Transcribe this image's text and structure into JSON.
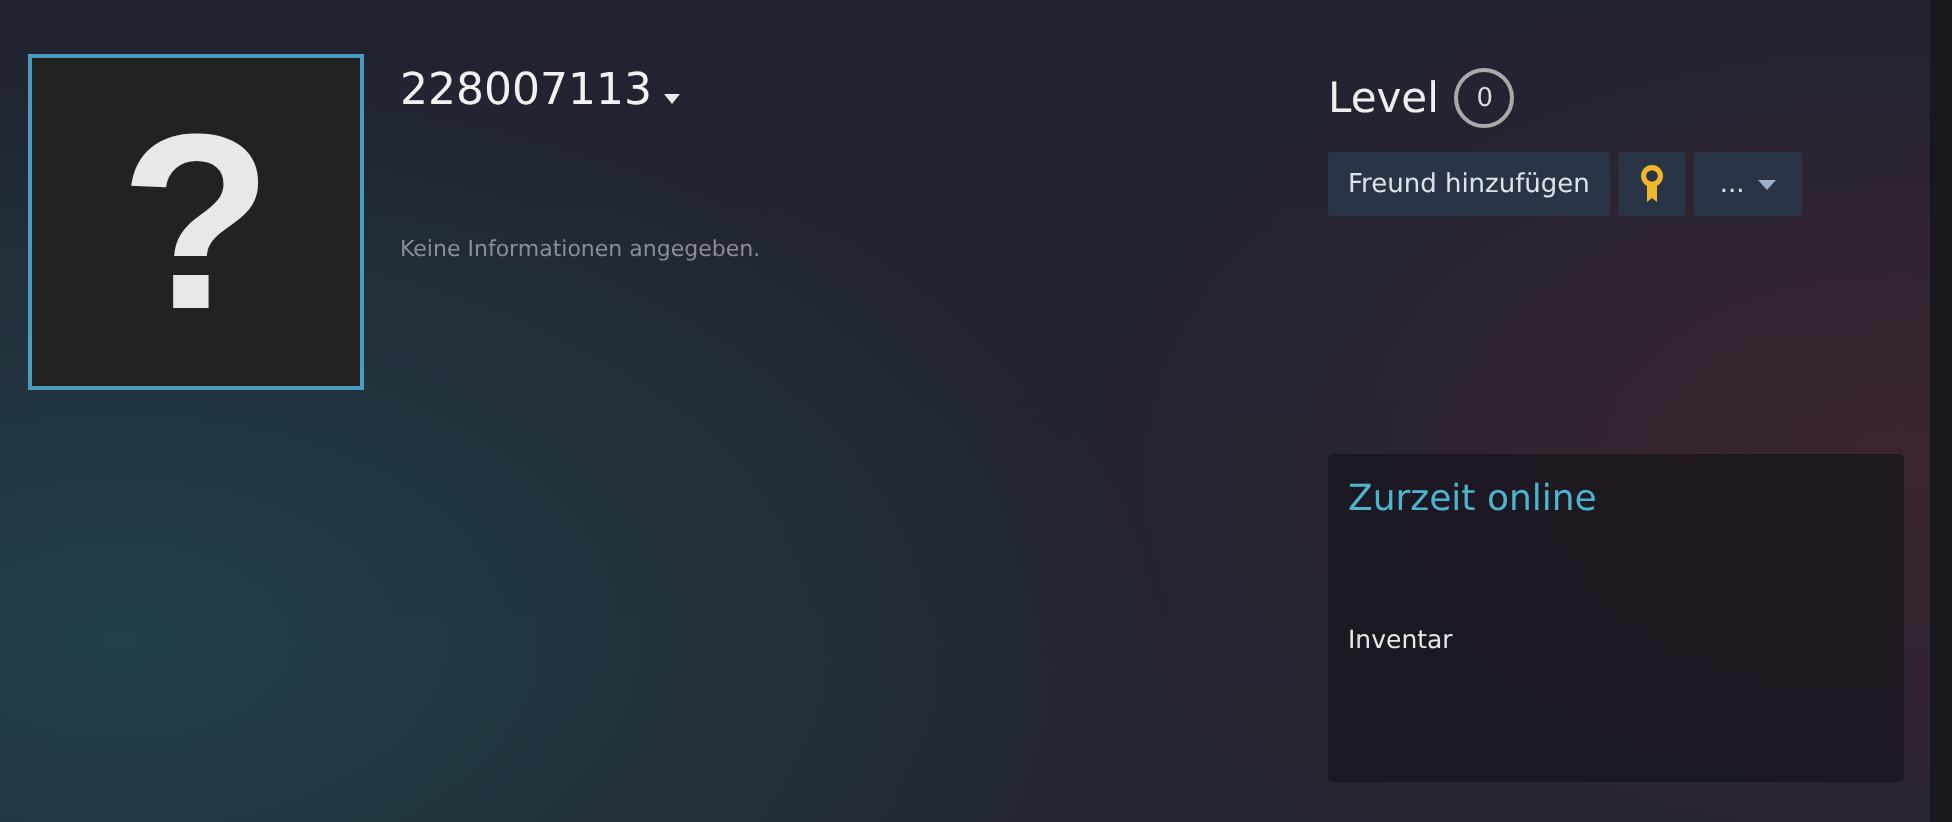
{
  "profile": {
    "avatar_glyph": "?",
    "name": "228007113",
    "summary": "Keine Informationen angegeben."
  },
  "level": {
    "label": "Level",
    "value": "0"
  },
  "actions": {
    "add_friend": "Freund hinzufügen",
    "more": "..."
  },
  "status_card": {
    "title": "Zurzeit online",
    "section": "Inventar"
  }
}
